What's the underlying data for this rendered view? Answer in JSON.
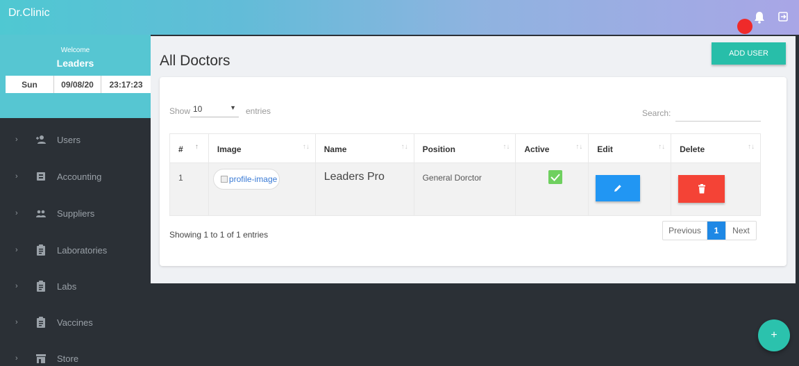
{
  "header": {
    "brand": "Dr.Clinic"
  },
  "welcome": {
    "greeting": "Welcome",
    "user": "Leaders",
    "day": "Sun",
    "date": "09/08/20",
    "time": "23:17:23"
  },
  "sidebar": {
    "items": [
      {
        "label": "Users",
        "icon": "users-icon"
      },
      {
        "label": "Accounting",
        "icon": "accounting-icon"
      },
      {
        "label": "Suppliers",
        "icon": "suppliers-icon"
      },
      {
        "label": "Laboratories",
        "icon": "clipboard-icon"
      },
      {
        "label": "Labs",
        "icon": "clipboard-icon"
      },
      {
        "label": "Vaccines",
        "icon": "clipboard-icon"
      },
      {
        "label": "Store",
        "icon": "store-icon"
      }
    ]
  },
  "main": {
    "title": "All Doctors",
    "add_button": "ADD USER",
    "table_controls": {
      "show": "Show",
      "length_value": "10",
      "entries": "entries",
      "search_label": "Search:"
    },
    "columns": [
      "#",
      "Image",
      "Name",
      "Position",
      "Active",
      "Edit",
      "Delete"
    ],
    "rows": [
      {
        "index": "1",
        "image_alt": "profile-image",
        "name": "Leaders Pro",
        "position": "General Dorctor"
      }
    ],
    "info": "Showing 1 to 1 of 1 entries",
    "pagination": {
      "previous": "Previous",
      "current": "1",
      "next": "Next"
    }
  },
  "fab": {
    "label": "+"
  },
  "colors": {
    "accent": "#28bea9",
    "edit": "#2196f3",
    "delete": "#f44336",
    "sidebar": "#2b3036",
    "active": "#6fd05f"
  }
}
